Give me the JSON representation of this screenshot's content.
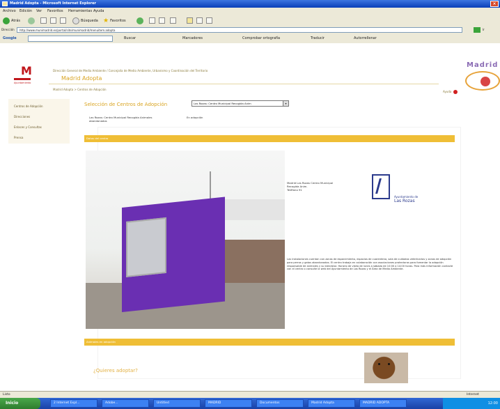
{
  "window": {
    "title": "Madrid Adopta - Microsoft Internet Explorer"
  },
  "menubar": [
    "Archivo",
    "Edición",
    "Ver",
    "Favoritos",
    "Herramientas",
    "Ayuda"
  ],
  "toolbar": {
    "back": "Atrás",
    "search": "Búsqueda",
    "favorites": "Favoritos"
  },
  "address": {
    "label": "Dirección",
    "url": "http://www.munimadrid.es/portal/site/munimadrid/menuitem.adopta",
    "go": "Ir"
  },
  "googlebar": {
    "label": "Google",
    "search": "Buscar",
    "marcadores": "Marcadores",
    "comprobar": "Comprobar ortografía",
    "traducir": "Traducir",
    "autocompletar": "Autorrellenar"
  },
  "page": {
    "logo": "M",
    "logo_caption": "Ayuntamiento",
    "directorate": "Dirección General de Medio Ambiente / Concejalía de Medio Ambiente, Urbanismo y Coordinación del Territorio",
    "brand": "Madrid Adopta",
    "breadcrumb": "Madrid Adopta > Centros de Adopción",
    "util": "Ayuda",
    "madrid_logo": "Madrid",
    "sidebar": [
      "Centros de Adopción",
      "Direcciones",
      "Enlaces y Consultas",
      "Prensa"
    ],
    "section_title": "Selección de Centros de Adopción",
    "select_value": "Las Rozas: Centro Municipal Recogida Anim",
    "center_name": "Las Rozas: Centro Municipal Recogida Animales abandonados",
    "center_note": "En adopción",
    "bar1": "Datos del centro",
    "address_lines": [
      "Madrid Las Rozas Centro Municipal",
      "Recogida Anim.",
      "Teléfono 91"
    ],
    "university": [
      "Ayuntamiento de",
      "Las Rozas"
    ],
    "description": "Las instalaciones cuentan con zonas de esparcimiento, espacios de cuarentena, sala de cuidados veterinarios y zonas de adopción para perros y gatos abandonados. El centro trabaja en colaboración con asociaciones protectoras para fomentar la adopción responsable de animales y su bienestar. Horario de visita de lunes a sábado de 10:00 a 14:00 horas. Para más información contacte con el centro o consulte la web del Ayuntamiento de Las Rozas y el Área de Medio Ambiente.",
    "bar2": "Animales en adopción",
    "question": "¿Quieres adoptar?"
  },
  "status": {
    "left": "Listo",
    "right": "Internet"
  },
  "taskbar": {
    "start": "Inicio",
    "tasks": [
      "2 Internet Expl...",
      "Adobe...",
      "Untitled",
      "MADRID",
      "Documentos",
      "Madrid Adopta",
      "MADRID ADOPTA"
    ],
    "clock": "12:00"
  }
}
